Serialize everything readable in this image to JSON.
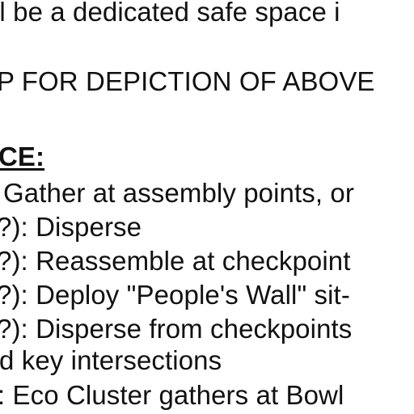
{
  "document": {
    "lines": [
      "ll be a dedicated safe space i",
      "P FOR DEPICTION OF ABOVE",
      "CE:",
      "Gather at assembly points, or",
      "?): Disperse",
      "?): Reassemble at checkpoint",
      "?): Deploy \"People's Wall\" sit-",
      "?): Disperse from checkpoints",
      "d key intersections",
      ": Eco Cluster gathers at Bowl"
    ]
  }
}
